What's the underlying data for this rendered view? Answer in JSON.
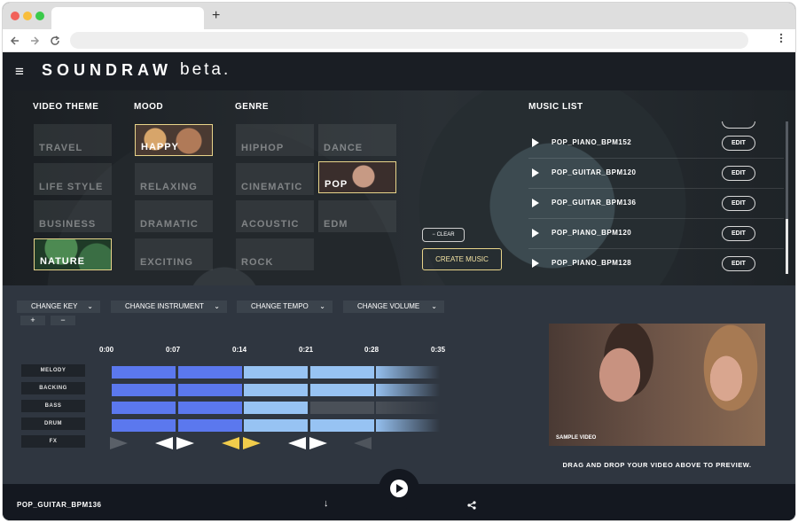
{
  "browser": {
    "new_tab_symbol": "+",
    "back_icon": "arrow-left-icon",
    "forward_icon": "arrow-right-icon",
    "reload_icon": "reload-icon",
    "menu_icon": "kebab-icon"
  },
  "colors": {
    "timeline_dark": "#5b78ee",
    "timeline_light": "#97c3f3",
    "timeline_empty": "#4a5058",
    "accent_gold": "#e8d48a",
    "fx_active": "#f1cc4b"
  },
  "header": {
    "menu_symbol": "≡",
    "brand": "SOUNDRAW",
    "brand_suffix": "beta."
  },
  "selector": {
    "video_theme": {
      "heading": "VIDEO THEME",
      "items": [
        "TRAVEL",
        "LIFE STYLE",
        "BUSINESS",
        "NATURE"
      ],
      "selected": "NATURE"
    },
    "mood": {
      "heading": "MOOD",
      "items": [
        "HAPPY",
        "RELAXING",
        "DRAMATIC",
        "EXCITING"
      ],
      "selected": "HAPPY"
    },
    "genre": {
      "heading": "GENRE",
      "items": [
        "HIPHOP",
        "DANCE",
        "CINEMATIC",
        "POP",
        "ACOUSTIC",
        "EDM",
        "ROCK"
      ],
      "selected": "POP"
    },
    "clear_label": "− CLEAR",
    "create_label": "CREATE MUSIC"
  },
  "music_list": {
    "heading": "MUSIC LIST",
    "edit_label": "EDIT",
    "items": [
      "POP_PIANO_BPM152",
      "POP_GUITAR_BPM120",
      "POP_GUITAR_BPM136",
      "POP_PIANO_BPM120",
      "POP_PIANO_BPM128"
    ]
  },
  "controls": {
    "dropdowns": [
      "CHANGE KEY",
      "CHANGE INSTRUMENT",
      "CHANGE TEMPO",
      "CHANGE VOLUME"
    ],
    "plus": "+",
    "minus": "−"
  },
  "timeline": {
    "times": [
      "0:00",
      "0:07",
      "0:14",
      "0:21",
      "0:28",
      "0:35"
    ],
    "tracks": [
      {
        "name": "MELODY",
        "segments": [
          "dark",
          "dark",
          "light",
          "light",
          "light"
        ]
      },
      {
        "name": "BACKING",
        "segments": [
          "dark",
          "dark",
          "light",
          "light",
          "light"
        ]
      },
      {
        "name": "BASS",
        "segments": [
          "dark",
          "dark",
          "light",
          "empty",
          "empty"
        ]
      },
      {
        "name": "DRUM",
        "segments": [
          "dark",
          "dark",
          "light",
          "light",
          "light"
        ]
      }
    ],
    "fx_label": "FX"
  },
  "preview": {
    "label": "SAMPLE VIDEO",
    "hint": "DRAG AND DROP YOUR VIDEO ABOVE TO PREVIEW."
  },
  "footer": {
    "current_track": "POP_GUITAR_BPM136",
    "download_symbol": "↓",
    "share_symbol": "<"
  }
}
